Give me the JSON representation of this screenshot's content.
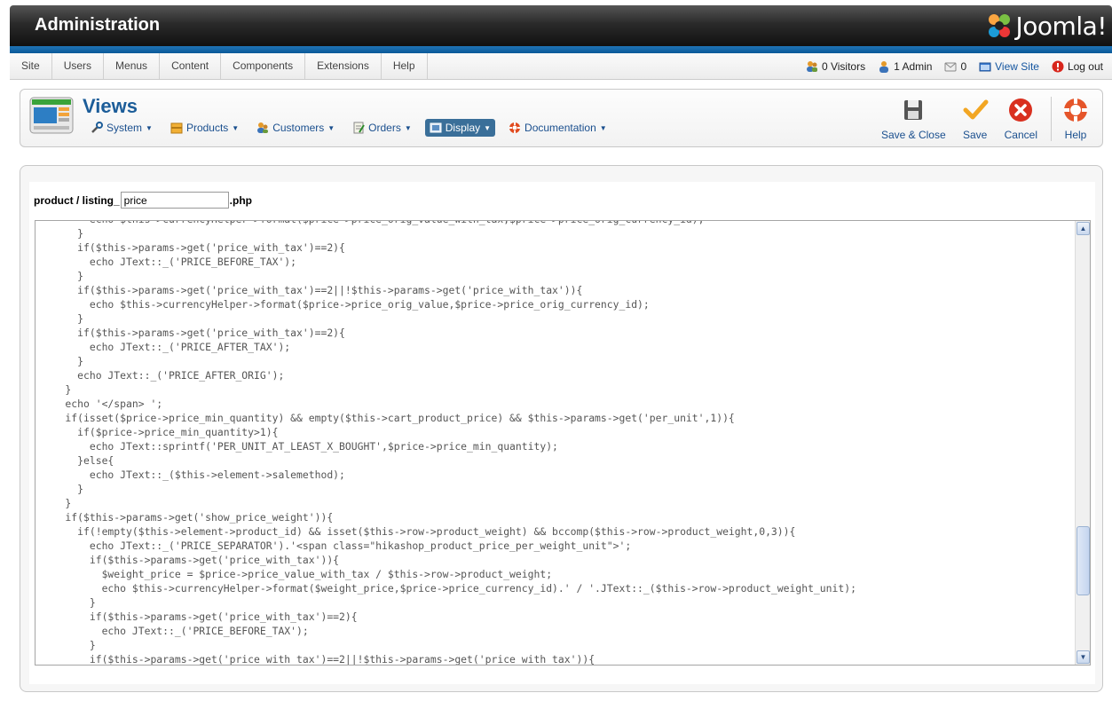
{
  "header": {
    "title": "Administration",
    "brand": "Joomla!"
  },
  "menu": [
    "Site",
    "Users",
    "Menus",
    "Content",
    "Components",
    "Extensions",
    "Help"
  ],
  "status": {
    "visitors": "0 Visitors",
    "admins": "1 Admin",
    "messages": "0",
    "view_site": "View Site",
    "logout": "Log out"
  },
  "toolbar": {
    "title": "Views",
    "submenu": [
      "System",
      "Products",
      "Customers",
      "Orders",
      "Display",
      "Documentation"
    ],
    "active_submenu": "Display",
    "actions": {
      "save_close": "Save & Close",
      "save": "Save",
      "cancel": "Cancel",
      "help": "Help"
    }
  },
  "editor": {
    "file_prefix": "product / listing_",
    "file_name": "price",
    "file_suffix": ".php",
    "code_lines": [
      "        echo $this->currencyHelper->format($price->price_orig_value_with_tax,$price->price_orig_currency_id);",
      "      }",
      "      if($this->params->get('price_with_tax')==2){",
      "        echo JText::_('PRICE_BEFORE_TAX');",
      "      }",
      "      if($this->params->get('price_with_tax')==2||!$this->params->get('price_with_tax')){",
      "        echo $this->currencyHelper->format($price->price_orig_value,$price->price_orig_currency_id);",
      "      }",
      "      if($this->params->get('price_with_tax')==2){",
      "        echo JText::_('PRICE_AFTER_TAX');",
      "      }",
      "      echo JText::_('PRICE_AFTER_ORIG');",
      "    }",
      "    echo '</span> ';",
      "    if(isset($price->price_min_quantity) && empty($this->cart_product_price) && $this->params->get('per_unit',1)){",
      "      if($price->price_min_quantity>1){",
      "        echo JText::sprintf('PER_UNIT_AT_LEAST_X_BOUGHT',$price->price_min_quantity);",
      "      }else{",
      "        echo JText::_($this->element->salemethod);",
      "      }",
      "    }",
      "    if($this->params->get('show_price_weight')){",
      "      if(!empty($this->element->product_id) && isset($this->row->product_weight) && bccomp($this->row->product_weight,0,3)){",
      "        echo JText::_('PRICE_SEPARATOR').'<span class=\"hikashop_product_price_per_weight_unit\">';",
      "        if($this->params->get('price_with_tax')){",
      "          $weight_price = $price->price_value_with_tax / $this->row->product_weight;",
      "          echo $this->currencyHelper->format($weight_price,$price->price_currency_id).' / '.JText::_($this->row->product_weight_unit);",
      "        }",
      "        if($this->params->get('price_with_tax')==2){",
      "          echo JText::_('PRICE_BEFORE_TAX');",
      "        }",
      "        if($this->params->get('price_with_tax')==2||!$this->params->get('price_with_tax')){"
    ]
  },
  "colors": {
    "accent": "#1c5d99",
    "header_bar": "#0b5a99",
    "code_text": "#555555"
  }
}
